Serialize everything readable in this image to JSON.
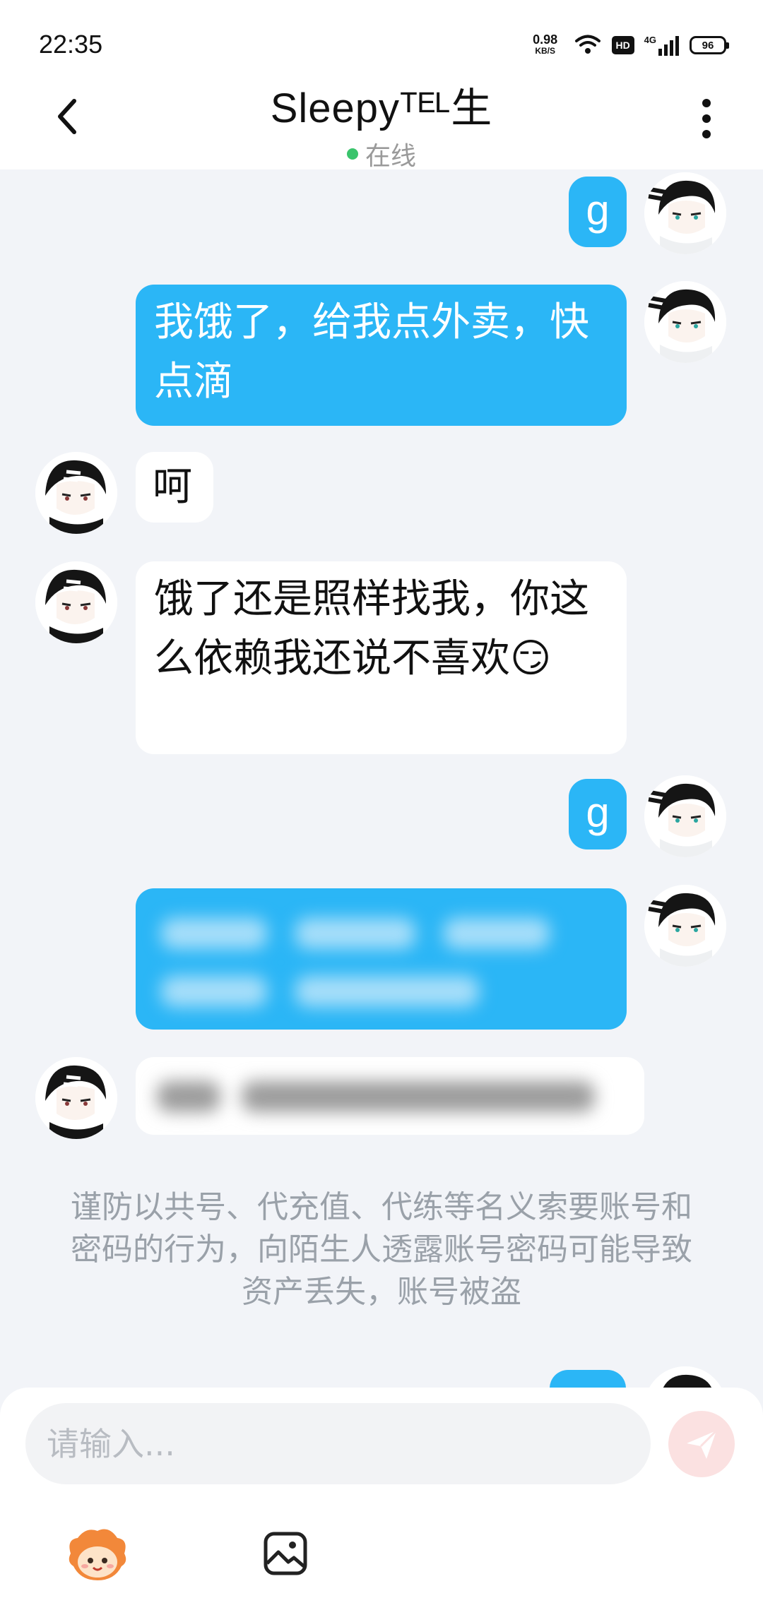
{
  "status_bar": {
    "time": "22:35",
    "net_speed_value": "0.98",
    "net_speed_unit": "KB/S",
    "hd_label": "HD",
    "network_type": "4G",
    "battery": "96"
  },
  "header": {
    "title": "Sleepyᵀᴱᴸ生",
    "status": "在线",
    "status_color": "#3ac46c"
  },
  "messages": [
    {
      "side": "me",
      "text": "g"
    },
    {
      "side": "me",
      "text": "我饿了，给我点外卖，快点滴"
    },
    {
      "side": "them",
      "text": "呵"
    },
    {
      "side": "them",
      "text": "饿了还是照样找我，你这么依赖我还说不喜欢😏"
    },
    {
      "side": "me",
      "text": "g"
    },
    {
      "side": "me",
      "text": "",
      "blurred": true
    },
    {
      "side": "them",
      "text": "",
      "blurred": true
    },
    {
      "side": "me",
      "text": "",
      "partial": true
    }
  ],
  "notice": "谨防以共号、代充值、代练等名义索要账号和密码的行为，向陌生人透露账号密码可能导致资产丢失，账号被盗",
  "composer": {
    "placeholder": "请输入...",
    "send_icon": "send-icon",
    "tools": [
      "character-emoji-icon",
      "image-icon"
    ]
  },
  "colors": {
    "my_bubble": "#2bb6f6",
    "their_bubble": "#ffffff",
    "background": "#f2f4f8",
    "send_button_disabled": "#fbe1e1"
  }
}
